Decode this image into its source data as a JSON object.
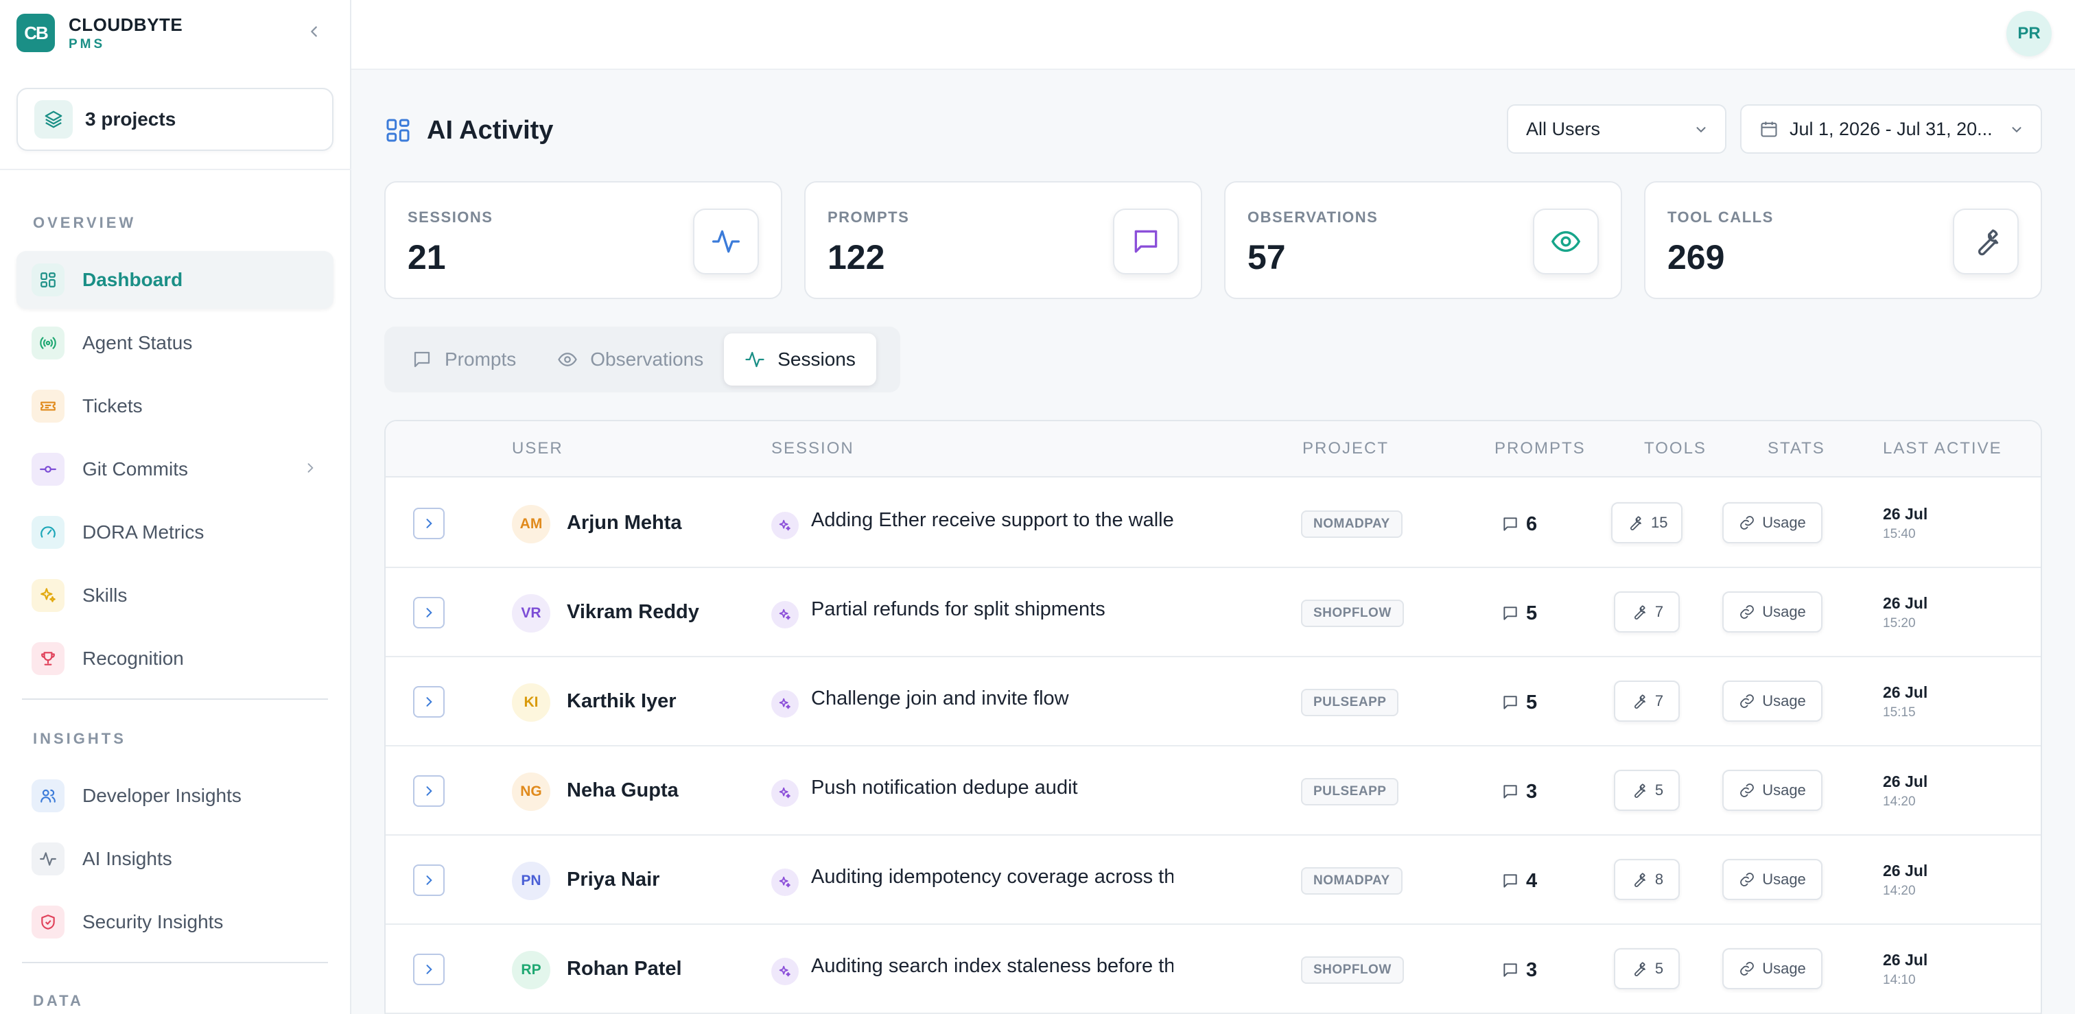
{
  "brand": {
    "logo_text": "CB",
    "name": "CLOUDBYTE",
    "sub": "PMS"
  },
  "projects": {
    "label": "3 projects"
  },
  "sidebar": {
    "sections": [
      {
        "label": "OVERVIEW"
      },
      {
        "label": "INSIGHTS"
      },
      {
        "label": "DATA"
      }
    ],
    "items": [
      {
        "label": "Dashboard",
        "icon": "dashboard-icon",
        "color": "#1a8f86",
        "bg": "#e6f4f2",
        "active": true
      },
      {
        "label": "Agent Status",
        "icon": "broadcast-icon",
        "color": "#1fa872",
        "bg": "#e6f6ee"
      },
      {
        "label": "Tickets",
        "icon": "ticket-icon",
        "color": "#e08a1c",
        "bg": "#fdf1e0"
      },
      {
        "label": "Git Commits",
        "icon": "git-commit-icon",
        "color": "#7c4dd6",
        "bg": "#f0eafb",
        "has_children": true
      },
      {
        "label": "DORA Metrics",
        "icon": "gauge-icon",
        "color": "#1ba6b8",
        "bg": "#e4f5f8"
      },
      {
        "label": "Skills",
        "icon": "sparkle-icon",
        "color": "#e2a90f",
        "bg": "#fdf5dc"
      },
      {
        "label": "Recognition",
        "icon": "trophy-icon",
        "color": "#e0415a",
        "bg": "#fde8ec"
      },
      {
        "label": "Developer Insights",
        "icon": "users-icon",
        "color": "#3b7bd9",
        "bg": "#e8f0fb"
      },
      {
        "label": "AI Insights",
        "icon": "activity-icon",
        "color": "#6b7684",
        "bg": "#f0f2f5"
      },
      {
        "label": "Security Insights",
        "icon": "shield-icon",
        "color": "#e0415a",
        "bg": "#fde8ec"
      }
    ]
  },
  "topbar": {
    "user_initials": "PR"
  },
  "header": {
    "title": "AI Activity",
    "users_filter": "All Users",
    "date_range": "Jul 1, 2026 - Jul 31, 20..."
  },
  "stats": [
    {
      "label": "SESSIONS",
      "value": "21",
      "icon": "activity-icon",
      "color": "#3b7bd9"
    },
    {
      "label": "PROMPTS",
      "value": "122",
      "icon": "message-icon",
      "color": "#8b4fd9"
    },
    {
      "label": "OBSERVATIONS",
      "value": "57",
      "icon": "eye-icon",
      "color": "#17a58a"
    },
    {
      "label": "TOOL CALLS",
      "value": "269",
      "icon": "wrench-icon",
      "color": "#4b5665"
    }
  ],
  "tabs": [
    {
      "label": "Prompts",
      "icon": "message-icon"
    },
    {
      "label": "Observations",
      "icon": "eye-icon"
    },
    {
      "label": "Sessions",
      "icon": "activity-icon",
      "active": true
    }
  ],
  "table": {
    "columns": [
      "USER",
      "SESSION",
      "PROJECT",
      "PROMPTS",
      "TOOLS",
      "STATS",
      "LAST ACTIVE"
    ],
    "usage_label": "Usage",
    "rows": [
      {
        "initials": "AM",
        "avatar_color": "#e08a1c",
        "avatar_bg": "#fdf1e0",
        "user": "Arjun Mehta",
        "session": "Adding Ether receive support to the wallet",
        "project": "NOMADPAY",
        "prompts": "6",
        "tools": "15",
        "date": "26 Jul",
        "time": "15:40"
      },
      {
        "initials": "VR",
        "avatar_color": "#7c4dd6",
        "avatar_bg": "#f1ecfb",
        "user": "Vikram Reddy",
        "session": "Partial refunds for split shipments",
        "project": "SHOPFLOW",
        "prompts": "5",
        "tools": "7",
        "date": "26 Jul",
        "time": "15:20"
      },
      {
        "initials": "KI",
        "avatar_color": "#d99a0b",
        "avatar_bg": "#fdf6dd",
        "user": "Karthik Iyer",
        "session": "Challenge join and invite flow",
        "project": "PULSEAPP",
        "prompts": "5",
        "tools": "7",
        "date": "26 Jul",
        "time": "15:15"
      },
      {
        "initials": "NG",
        "avatar_color": "#e08a1c",
        "avatar_bg": "#fdf1e0",
        "user": "Neha Gupta",
        "session": "Push notification dedupe audit",
        "project": "PULSEAPP",
        "prompts": "3",
        "tools": "5",
        "date": "26 Jul",
        "time": "14:20"
      },
      {
        "initials": "PN",
        "avatar_color": "#4a5fd6",
        "avatar_bg": "#eaedfb",
        "user": "Priya Nair",
        "session": "Auditing idempotency coverage across the",
        "project": "NOMADPAY",
        "prompts": "4",
        "tools": "8",
        "date": "26 Jul",
        "time": "14:20"
      },
      {
        "initials": "RP",
        "avatar_color": "#1fa872",
        "avatar_bg": "#e3f6ec",
        "user": "Rohan Patel",
        "session": "Auditing search index staleness before the",
        "project": "SHOPFLOW",
        "prompts": "3",
        "tools": "5",
        "date": "26 Jul",
        "time": "14:10"
      }
    ]
  }
}
